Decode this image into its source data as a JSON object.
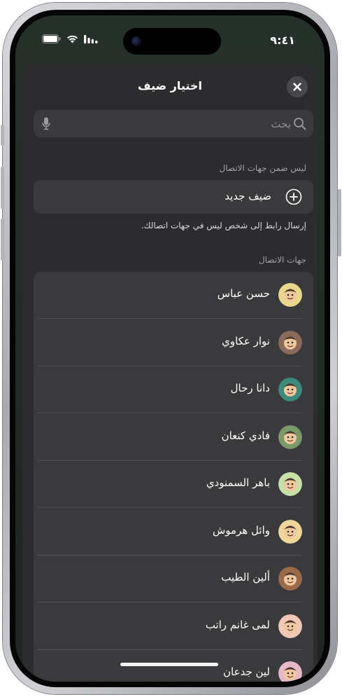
{
  "status_bar": {
    "time": "٩:٤١"
  },
  "sheet": {
    "title": "اختيار ضيف",
    "search_placeholder": "بحث",
    "not_in_contacts_header": "ليس ضمن جهات الاتصال",
    "new_guest_label": "ضيف جديد",
    "new_guest_footnote": "إرسال رابط إلى شخص ليس في جهات اتصالك.",
    "contacts_header": "جهات الاتصال",
    "contacts": [
      {
        "name": "حسن عباس",
        "avatar_color": "#e8d88a"
      },
      {
        "name": "نوار عكاوي",
        "avatar_color": "#8a6a5a"
      },
      {
        "name": "دانا رحال",
        "avatar_color": "#3b8a7a"
      },
      {
        "name": "فادي كنعان",
        "avatar_color": "#7a9a6a"
      },
      {
        "name": "باهر السمنودي",
        "avatar_color": "#c7e0a8"
      },
      {
        "name": "وائل هرموش",
        "avatar_color": "#efd79a"
      },
      {
        "name": "ألين الطيب",
        "avatar_color": "#9a6a4a"
      },
      {
        "name": "لمى غانم راتب",
        "avatar_color": "#f1c7b5"
      },
      {
        "name": "لين جدعان",
        "avatar_color": "#e6b8c8"
      }
    ]
  },
  "icons": {
    "close": "close-icon",
    "search": "search-icon",
    "mic": "mic-icon",
    "add": "plus-circle-icon",
    "wifi": "wifi-icon",
    "battery": "battery-icon",
    "signal": "signal-icon"
  },
  "colors": {
    "sheet_bg": "#2c2c2e",
    "card_bg": "#3a3a3d",
    "secondary_text": "#a0a0a5"
  }
}
